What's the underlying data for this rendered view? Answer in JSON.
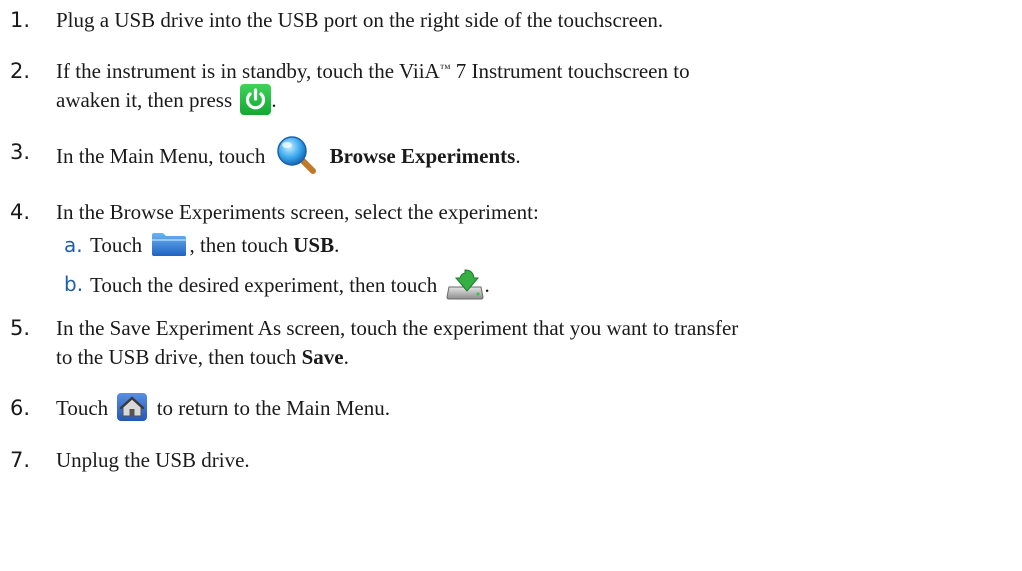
{
  "steps": [
    {
      "num": "1.",
      "text": "Plug a USB drive into the USB port on the right side of the touchscreen."
    },
    {
      "num": "2.",
      "text_a": "If the instrument is in standby, touch the ViiA",
      "tm": "™",
      "text_b": " 7 Instrument touchscreen to",
      "text_c": "awaken it, then press",
      "text_d": ".",
      "icon": "power-icon"
    },
    {
      "num": "3.",
      "text_a": "In the Main Menu, touch",
      "bold": "Browse Experiments",
      "text_b": ".",
      "icon": "search-icon"
    },
    {
      "num": "4.",
      "text": "In the Browse Experiments screen, select the experiment:",
      "substeps": [
        {
          "num": "a.",
          "text_a": "Touch",
          "text_b": ", then touch",
          "bold": "USB",
          "text_c": ".",
          "icon": "folder-icon"
        },
        {
          "num": "b.",
          "text_a": "Touch the desired experiment, then touch",
          "text_b": ".",
          "icon": "download-icon"
        }
      ]
    },
    {
      "num": "5.",
      "text_a": "In the Save Experiment As screen, touch the experiment that you want to transfer",
      "text_b": "to the USB drive, then touch",
      "bold": "Save",
      "text_c": "."
    },
    {
      "num": "6.",
      "text_a": "Touch",
      "text_b": "to return to the Main Menu.",
      "icon": "home-icon"
    },
    {
      "num": "7.",
      "text": "Unplug the USB drive."
    }
  ],
  "colors": {
    "step_number": "#1a1a1a",
    "substep_letter": "#1f5fa8",
    "power_green": "#22b83c",
    "search_blue": "#2e9be6",
    "folder_blue": "#2a78d4",
    "download_green": "#2ea83a"
  }
}
